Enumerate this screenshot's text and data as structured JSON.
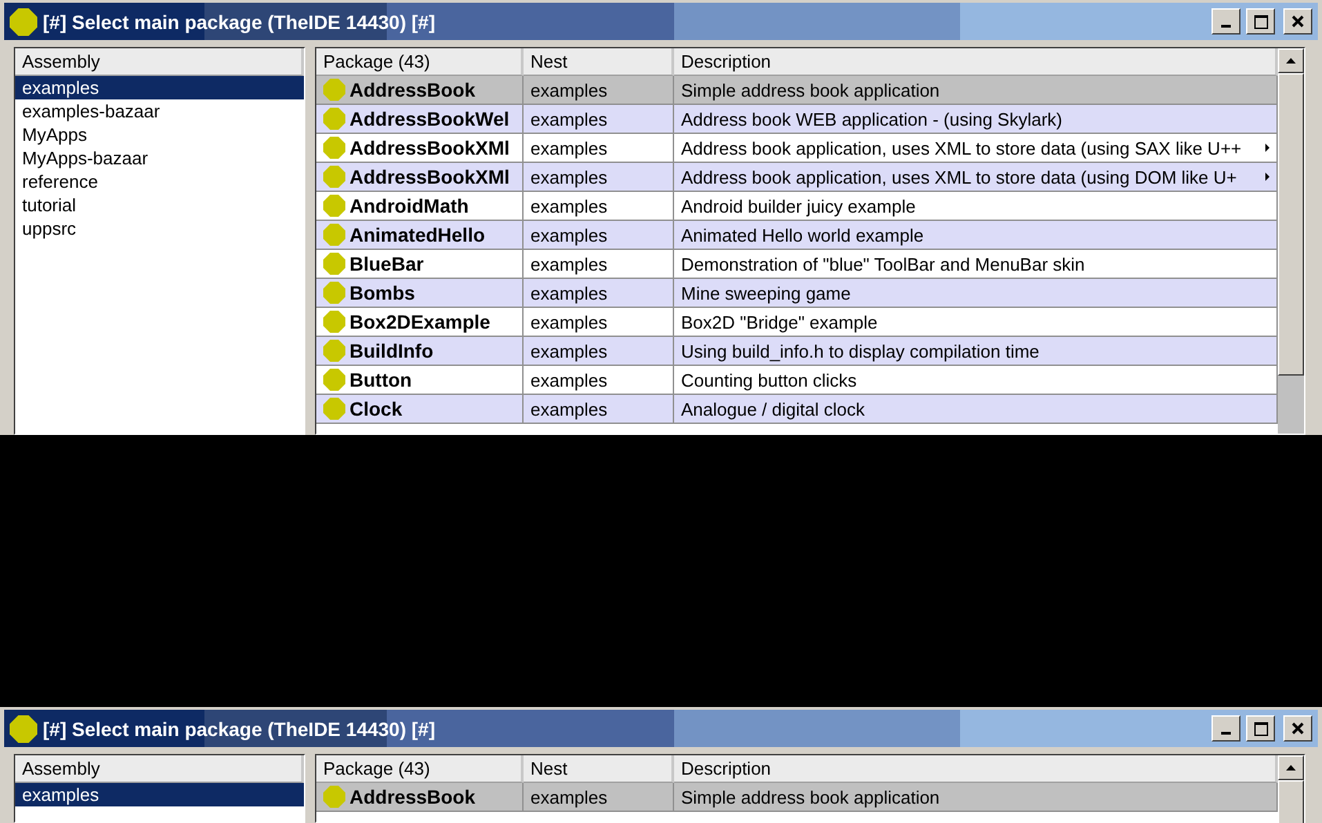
{
  "windows": [
    {
      "title": "[#] Select main package (TheIDE 14430) [#]",
      "assembly_header": "Assembly",
      "assemblies": [
        {
          "label": "examples",
          "selected": true
        },
        {
          "label": "examples-bazaar",
          "selected": false
        },
        {
          "label": "MyApps",
          "selected": false
        },
        {
          "label": "MyApps-bazaar",
          "selected": false
        },
        {
          "label": "reference",
          "selected": false
        },
        {
          "label": "tutorial",
          "selected": false
        },
        {
          "label": "uppsrc",
          "selected": false
        }
      ],
      "columns": [
        "Package (43)",
        "Nest",
        "Description"
      ],
      "rows": [
        {
          "package": "AddressBook",
          "nest": "examples",
          "description": "Simple address book application",
          "selected": true,
          "truncated": false
        },
        {
          "package": "AddressBookWel",
          "nest": "examples",
          "description": "Address book WEB application - (using Skylark)",
          "selected": false,
          "truncated": false
        },
        {
          "package": "AddressBookXMl",
          "nest": "examples",
          "description": "Address book application, uses XML to store data (using SAX like U++",
          "selected": false,
          "truncated": true
        },
        {
          "package": "AddressBookXMl",
          "nest": "examples",
          "description": "Address book application, uses XML to store data (using DOM like U+",
          "selected": false,
          "truncated": true
        },
        {
          "package": "AndroidMath",
          "nest": "examples",
          "description": "Android builder juicy example",
          "selected": false,
          "truncated": false
        },
        {
          "package": "AnimatedHello",
          "nest": "examples",
          "description": "Animated Hello world example",
          "selected": false,
          "truncated": false
        },
        {
          "package": "BlueBar",
          "nest": "examples",
          "description": "Demonstration of \"blue\" ToolBar and MenuBar skin",
          "selected": false,
          "truncated": false
        },
        {
          "package": "Bombs",
          "nest": "examples",
          "description": "Mine sweeping game",
          "selected": false,
          "truncated": false
        },
        {
          "package": "Box2DExample",
          "nest": "examples",
          "description": "Box2D \"Bridge\" example",
          "selected": false,
          "truncated": false
        },
        {
          "package": "BuildInfo",
          "nest": "examples",
          "description": "Using build_info.h to display compilation time",
          "selected": false,
          "truncated": false
        },
        {
          "package": "Button",
          "nest": "examples",
          "description": "Counting button clicks",
          "selected": false,
          "truncated": false
        },
        {
          "package": "Clock",
          "nest": "examples",
          "description": "Analogue / digital clock",
          "selected": false,
          "truncated": false
        }
      ]
    },
    {
      "title": "[#] Select main package (TheIDE 14430) [#]",
      "assembly_header": "Assembly",
      "assemblies": [
        {
          "label": "examples",
          "selected": true
        }
      ],
      "columns": [
        "Package (43)",
        "Nest",
        "Description"
      ],
      "rows": [
        {
          "package": "AddressBook",
          "nest": "examples",
          "description": "Simple address book application",
          "selected": true,
          "truncated": false
        }
      ]
    }
  ]
}
